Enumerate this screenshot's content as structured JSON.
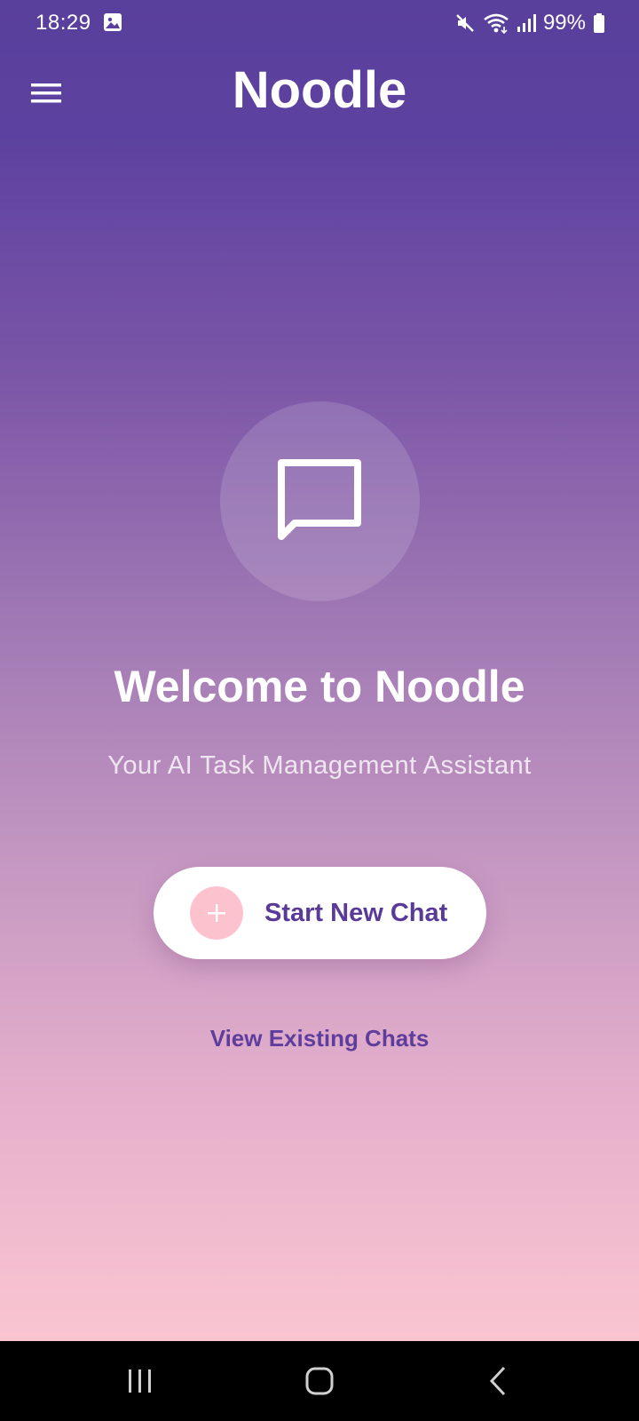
{
  "status_bar": {
    "time": "18:29",
    "battery": "99%",
    "icons": [
      "image-icon",
      "mute-icon",
      "wifi-icon",
      "signal-icon",
      "battery-icon"
    ]
  },
  "app_bar": {
    "title": "Noodle",
    "menu_icon": "hamburger-menu-icon"
  },
  "hero": {
    "icon": "chat-bubble-icon",
    "welcome": "Welcome to Noodle",
    "subtitle": "Your AI Task Management Assistant"
  },
  "actions": {
    "start_chat_label": "Start New Chat",
    "start_chat_icon": "plus-icon",
    "view_chats_label": "View Existing Chats"
  },
  "nav_bar": {
    "buttons": [
      "recent-apps-icon",
      "home-icon",
      "back-icon"
    ]
  },
  "colors": {
    "gradient_top": "#59409c",
    "gradient_bottom": "#fac5d1",
    "accent": "#5a3a98",
    "plus_circle": "#fcc3cf"
  }
}
